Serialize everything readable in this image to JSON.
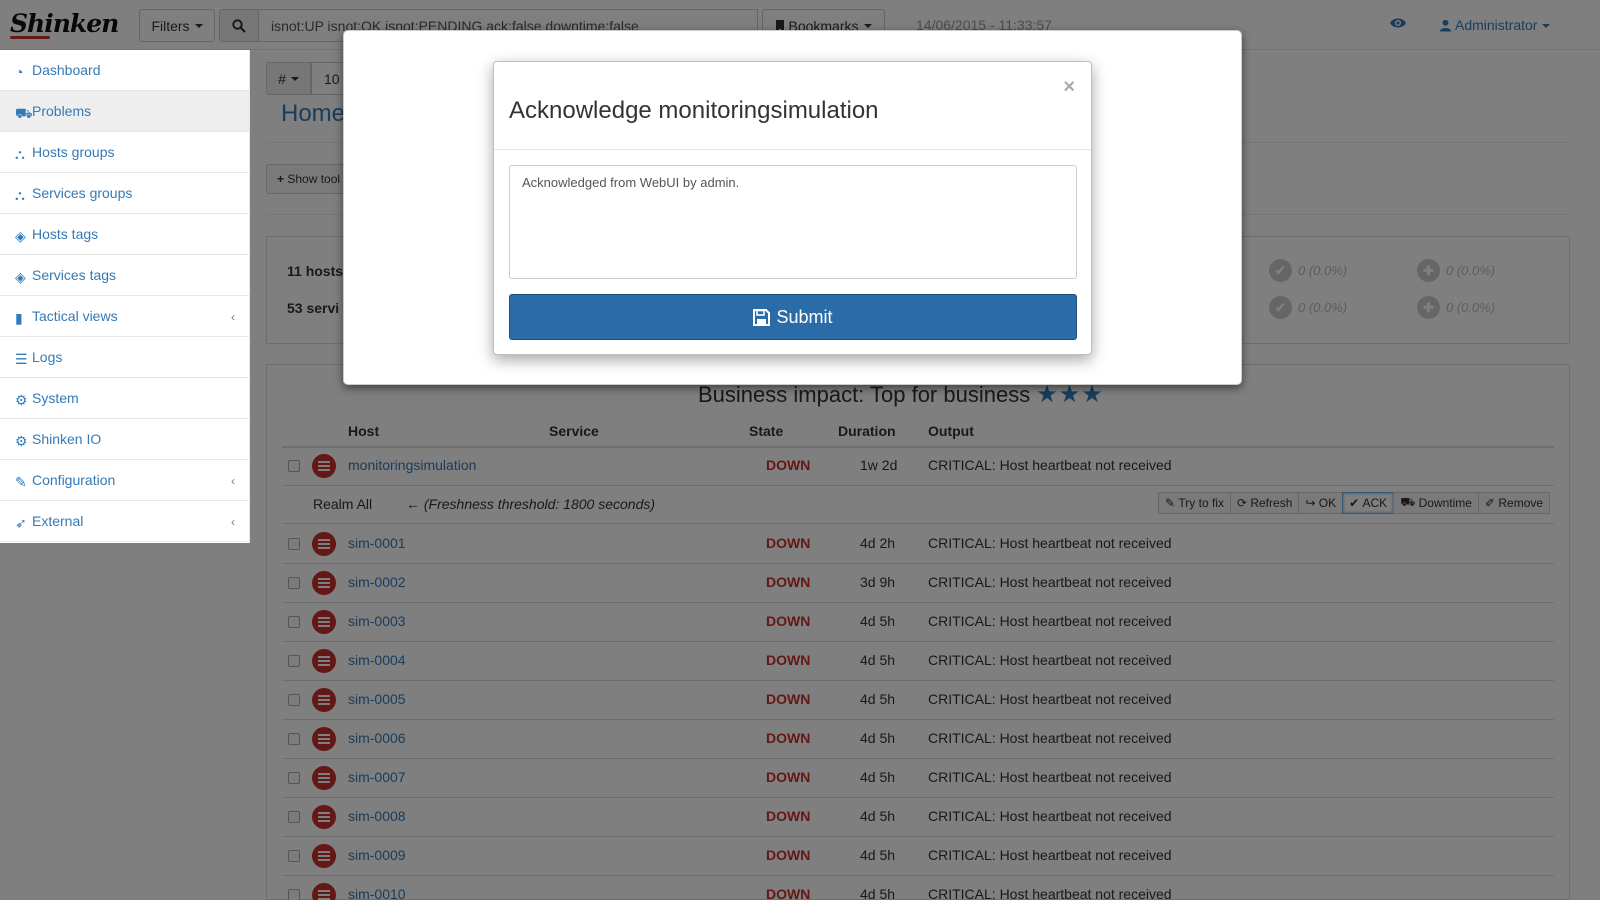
{
  "app": {
    "brand": "Shinken"
  },
  "navbar": {
    "filters_label": "Filters",
    "search_value": "isnot:UP isnot:OK isnot:PENDING ack:false downtime:false",
    "bookmarks_label": "Bookmarks",
    "datetime": "14/06/2015 - 11:33:57",
    "user_label": "Administrator"
  },
  "sidebar": {
    "items": [
      {
        "label": "Dashboard",
        "icon": "dashboard-icon"
      },
      {
        "label": "Problems",
        "icon": "ambulance-icon",
        "active": true
      },
      {
        "label": "Hosts groups",
        "icon": "sitemap-icon"
      },
      {
        "label": "Services groups",
        "icon": "sitemap-icon"
      },
      {
        "label": "Hosts tags",
        "icon": "tags-icon"
      },
      {
        "label": "Services tags",
        "icon": "tags-icon"
      },
      {
        "label": "Tactical views",
        "icon": "bar-chart-icon",
        "expandable": true
      },
      {
        "label": "Logs",
        "icon": "list-icon"
      },
      {
        "label": "System",
        "icon": "gears-icon"
      },
      {
        "label": "Shinken IO",
        "icon": "gears-icon"
      },
      {
        "label": "Configuration",
        "icon": "wrench-icon",
        "expandable": true
      },
      {
        "label": "External",
        "icon": "rocket-icon",
        "expandable": true
      }
    ]
  },
  "main": {
    "hash_label": "#",
    "page_value": "10",
    "breadcrumb": "Home",
    "show_toolbar_label": "Show tool",
    "summary": {
      "hosts_label": "11 hosts",
      "services_label": "53 servi",
      "stats": [
        "0 (0.0%)",
        "0 (0.0%)",
        "0 (0.0%)",
        "0 (0.0%)"
      ]
    },
    "business_impact_title": "Business impact: Top for business",
    "stars": "★★★",
    "columns": {
      "host": "Host",
      "service": "Service",
      "state": "State",
      "duration": "Duration",
      "output": "Output"
    },
    "detail": {
      "realm": "Realm All",
      "freshness": "(Freshness threshold: 1800 seconds)",
      "actions": [
        "Try to fix",
        "Refresh",
        "OK",
        "ACK",
        "Downtime",
        "Remove"
      ]
    },
    "rows": [
      {
        "host": "monitoringsimulation",
        "state": "DOWN",
        "duration": "1w 2d",
        "output": "CRITICAL: Host heartbeat not received"
      },
      {
        "host": "sim-0001",
        "state": "DOWN",
        "duration": "4d 2h",
        "output": "CRITICAL: Host heartbeat not received"
      },
      {
        "host": "sim-0002",
        "state": "DOWN",
        "duration": "3d 9h",
        "output": "CRITICAL: Host heartbeat not received"
      },
      {
        "host": "sim-0003",
        "state": "DOWN",
        "duration": "4d 5h",
        "output": "CRITICAL: Host heartbeat not received"
      },
      {
        "host": "sim-0004",
        "state": "DOWN",
        "duration": "4d 5h",
        "output": "CRITICAL: Host heartbeat not received"
      },
      {
        "host": "sim-0005",
        "state": "DOWN",
        "duration": "4d 5h",
        "output": "CRITICAL: Host heartbeat not received"
      },
      {
        "host": "sim-0006",
        "state": "DOWN",
        "duration": "4d 5h",
        "output": "CRITICAL: Host heartbeat not received"
      },
      {
        "host": "sim-0007",
        "state": "DOWN",
        "duration": "4d 5h",
        "output": "CRITICAL: Host heartbeat not received"
      },
      {
        "host": "sim-0008",
        "state": "DOWN",
        "duration": "4d 5h",
        "output": "CRITICAL: Host heartbeat not received"
      },
      {
        "host": "sim-0009",
        "state": "DOWN",
        "duration": "4d 5h",
        "output": "CRITICAL: Host heartbeat not received"
      },
      {
        "host": "sim-0010",
        "state": "DOWN",
        "duration": "4d 5h",
        "output": "CRITICAL: Host heartbeat not received"
      }
    ]
  },
  "modal": {
    "title": "Acknowledge monitoringsimulation",
    "close": "×",
    "comment": "Acknowledged from WebUI by admin.",
    "submit_label": "Submit"
  },
  "colors": {
    "accent": "#337ab7",
    "danger": "#c9302c",
    "submit": "#2a6ca8"
  }
}
